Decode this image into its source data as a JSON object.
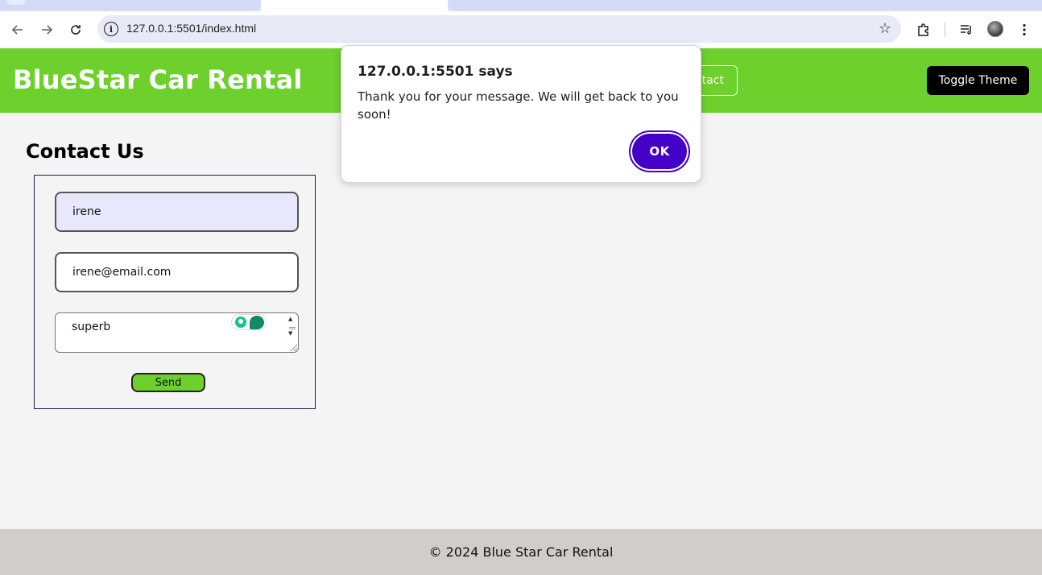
{
  "browser": {
    "url": "127.0.0.1:5501/index.html",
    "icons": {
      "back": "arrow-left-icon",
      "forward": "arrow-right-icon",
      "reload": "reload-icon",
      "info": "info-icon",
      "bookmark": "star-icon",
      "extensions": "puzzle-icon",
      "media": "media-queue-icon",
      "menu": "kebab-menu-icon"
    }
  },
  "header": {
    "title": "BlueStar Car Rental",
    "nav_partial": "ntact",
    "toggle_label": "Toggle Theme",
    "accent": "#6dd02d"
  },
  "contact": {
    "title": "Contact Us",
    "name_value": "irene",
    "email_value": "irene@email.com",
    "message_value": "superb",
    "send_label": "Send"
  },
  "footer": {
    "text": "© 2024 Blue Star Car Rental"
  },
  "alert": {
    "title": "127.0.0.1:5501 says",
    "message": "Thank you for your message. We will get back to you soon!",
    "ok_label": "OK",
    "accent": "#4400c8"
  }
}
